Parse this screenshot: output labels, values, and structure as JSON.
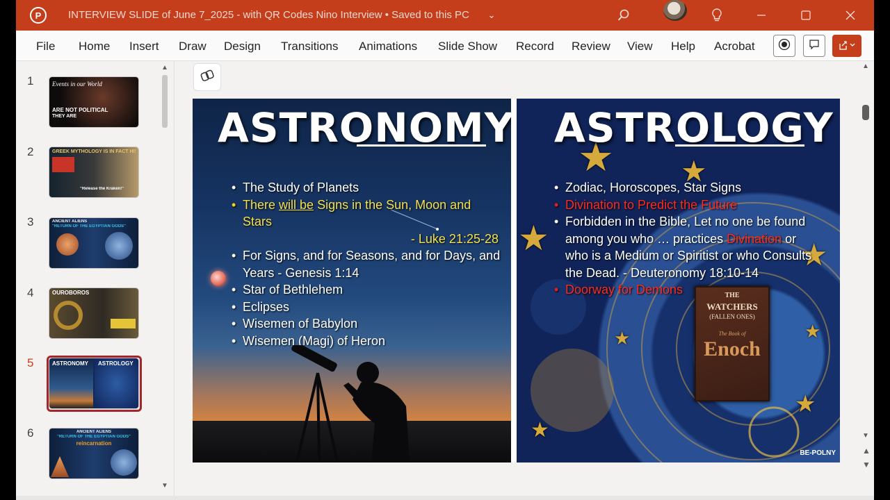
{
  "titlebar": {
    "document_title": "INTERVIEW SLIDE of June 7_2025 - with QR Codes Nino Interview • Saved to this PC",
    "app_icon": "powerpoint-icon",
    "accent_color": "#c43e1c"
  },
  "menu": {
    "items": [
      "File",
      "Home",
      "Insert",
      "Draw",
      "Design",
      "Transitions",
      "Animations",
      "Slide Show",
      "Record",
      "Review",
      "View",
      "Help",
      "Acrobat"
    ]
  },
  "thumbnails": {
    "numbers": [
      "1",
      "2",
      "3",
      "4",
      "5",
      "6"
    ],
    "active_index": 5,
    "slide1": {
      "line1": "Events in our World",
      "line2": "ARE NOT POLITICAL",
      "line3": "THEY ARE"
    },
    "slide2": {
      "line1": "GREEK MYTHOLOGY IS IN FACT HISTORY",
      "line2": "\"Release the Kraken!\""
    },
    "slide3": {
      "line1": "ANCIENT ALIENS",
      "line2": "\"RETURN OF THE EGYPTIAN GODS\""
    },
    "slide4": {
      "line1": "OUROBOROS"
    },
    "slide5": {
      "left": "ASTRONOMY",
      "right": "ASTROLOGY"
    },
    "slide6": {
      "line1": "ANCIENT ALIENS",
      "line2": "\"RETURN OF THE EGYPTIAN GODS\"",
      "line3": "reincarnation"
    }
  },
  "slide": {
    "left": {
      "heading": "ASTRONOMY",
      "b1": "The Study of Planets",
      "b2_pre": "There ",
      "b2_under": "will be",
      "b2_post": " Signs in the Sun, Moon and Stars",
      "b2_ref": "- Luke 21:25-28",
      "b3_line1": "For Signs, and for Seasons, and for Days, and",
      "b3_line2": "Years - Genesis 1:14",
      "b4": "Star of Bethlehem",
      "b5": "Eclipses",
      "b6": "Wisemen of Babylon",
      "b7": "Wisemen (Magi) of Heron"
    },
    "right": {
      "heading": "ASTROLOGY",
      "b1": "Zodiac, Horoscopes, Star Signs",
      "b2_red": "Divination",
      "b2_rest": " to Predict the Future",
      "b3_line1": "Forbidden in the Bible, Let no one be found",
      "b3_line2_pre": "among you who … practices ",
      "b3_line2_red": "Divination",
      "b3_line2_post": " or",
      "b3_line3": "who is a Medium or Spiritist or who Consults",
      "b3_line4": "the Dead. - Deuteronomy 18:10-14",
      "b4_red": "Doorway for Demons",
      "book_line1": "THE",
      "book_line2": "WATCHERS",
      "book_line3": "(FALLEN ONES)",
      "book_line4": "The Book of",
      "book_line5": "Enoch",
      "logo": "BE-POLNY"
    }
  },
  "icons": {
    "search": "search-icon",
    "lightbulb": "lightbulb-icon",
    "minimize": "minimize-icon",
    "maximize": "maximize-icon",
    "close": "close-icon",
    "record": "record-icon",
    "comments": "comments-icon",
    "share": "share-icon",
    "copilot": "copilot-icon"
  }
}
